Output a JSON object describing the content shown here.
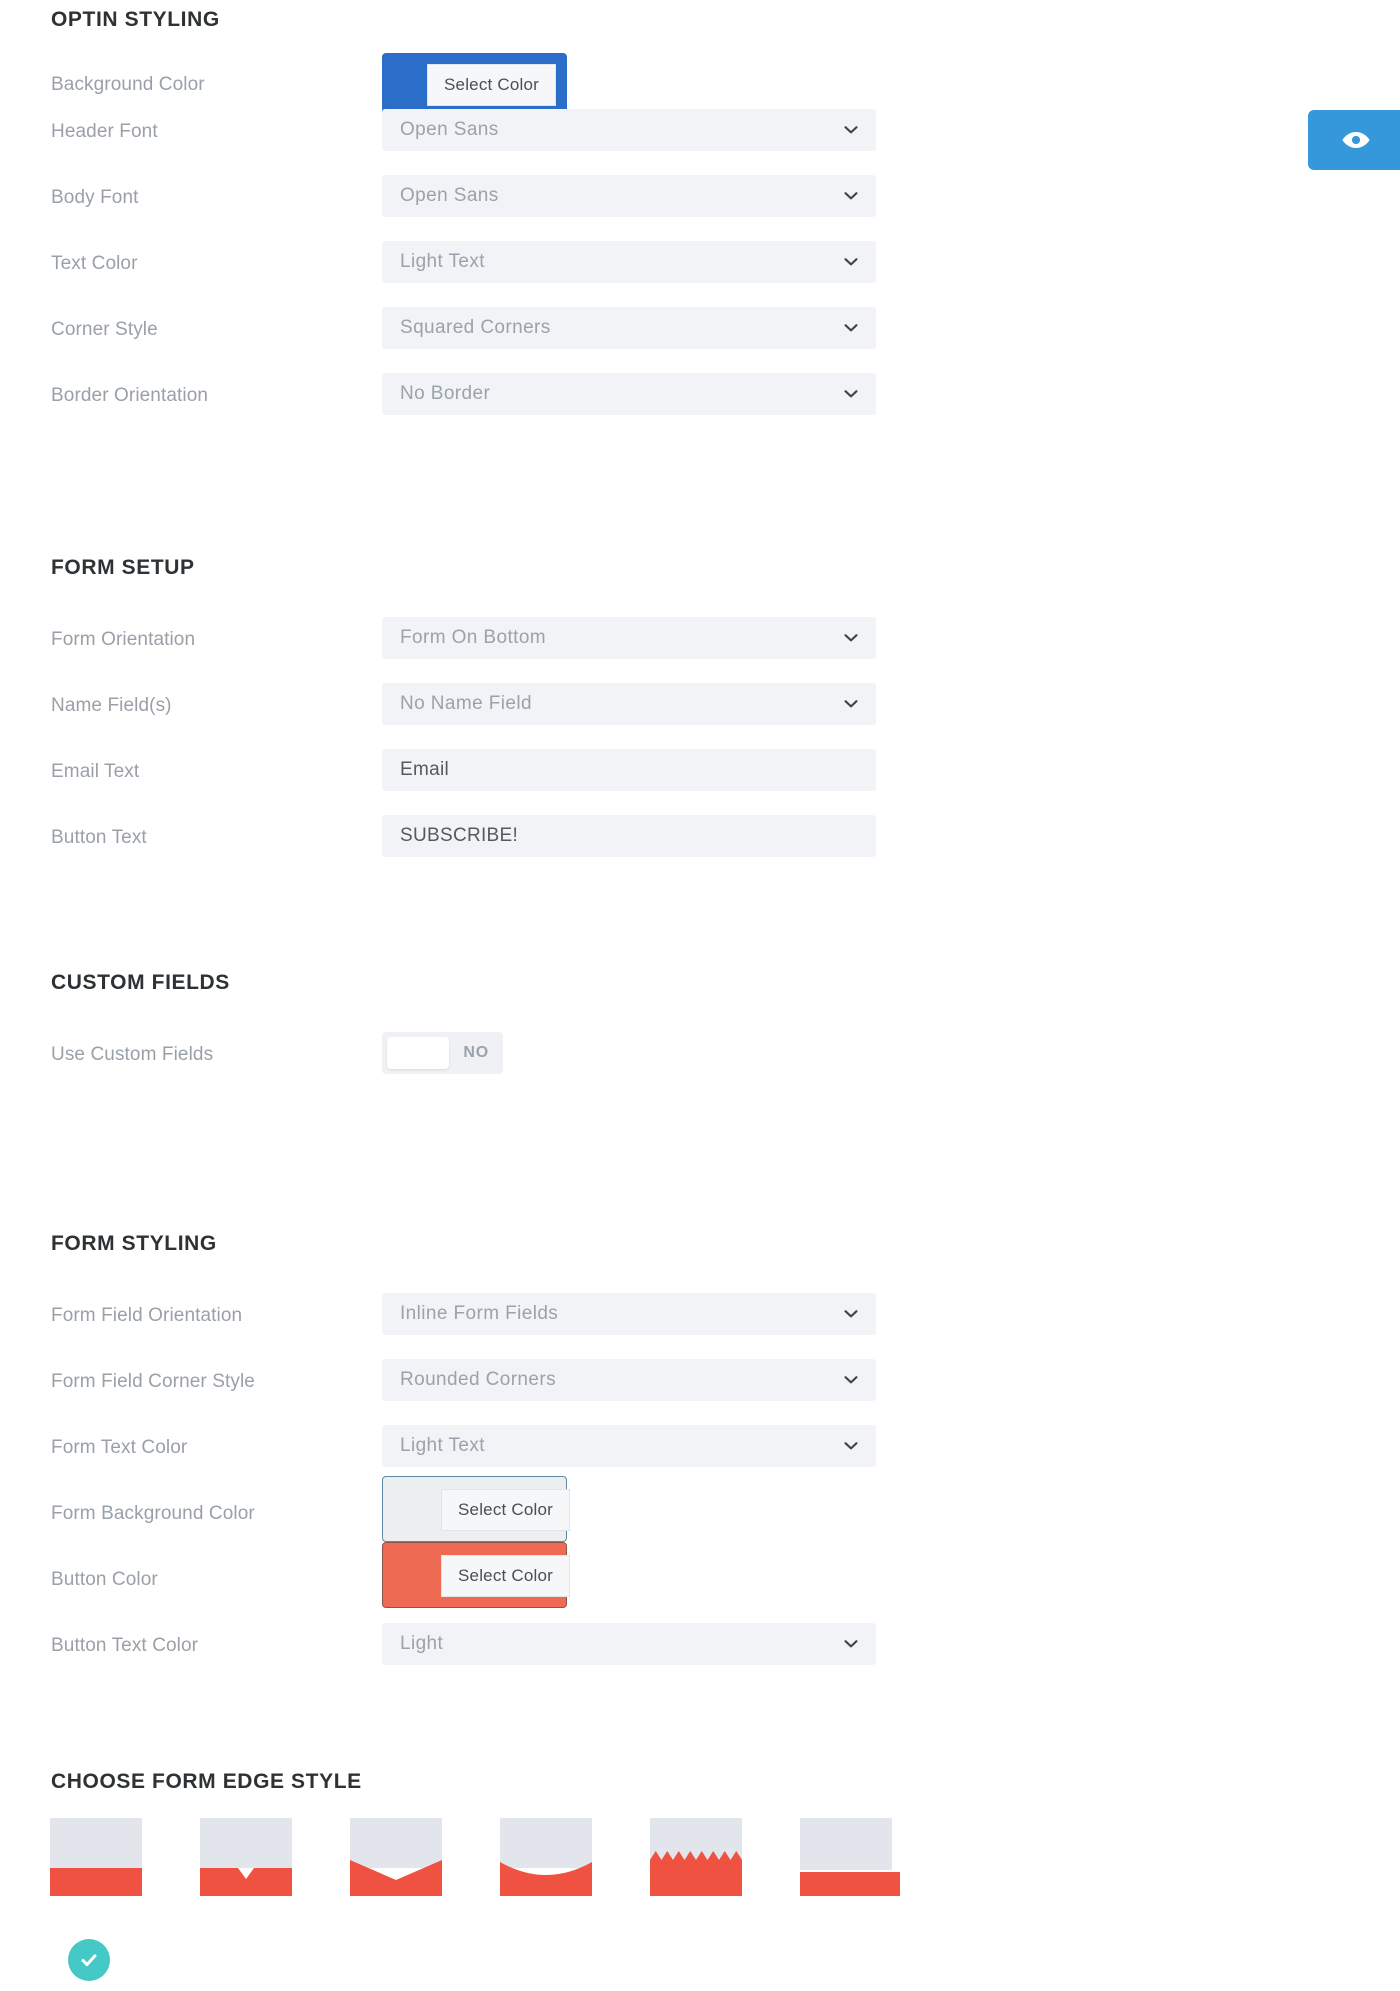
{
  "colors": {
    "background_color_swatch": "#2a6ec9",
    "form_background_color_swatch": "#eceef0",
    "button_color_swatch": "#ef6a52",
    "accent_blue": "#3498db",
    "check_teal": "#45c9c6",
    "edge_fill_red": "#ef5241",
    "edge_fill_gray": "#e2e5ec"
  },
  "sections": {
    "optin_styling": {
      "title": "OPTIN STYLING",
      "rows": [
        {
          "label": "Background Color",
          "type": "color",
          "button_label": "Select Color"
        },
        {
          "label": "Header Font",
          "type": "select",
          "value": "Open Sans"
        },
        {
          "label": "Body Font",
          "type": "select",
          "value": "Open Sans"
        },
        {
          "label": "Text Color",
          "type": "select",
          "value": "Light Text"
        },
        {
          "label": "Corner Style",
          "type": "select",
          "value": "Squared Corners"
        },
        {
          "label": "Border Orientation",
          "type": "select",
          "value": "No Border"
        }
      ]
    },
    "form_setup": {
      "title": "FORM SETUP",
      "rows": [
        {
          "label": "Form Orientation",
          "type": "select",
          "value": "Form On Bottom"
        },
        {
          "label": "Name Field(s)",
          "type": "select",
          "value": "No Name Field"
        },
        {
          "label": "Email Text",
          "type": "input",
          "value": "Email"
        },
        {
          "label": "Button Text",
          "type": "input",
          "value": "SUBSCRIBE!"
        }
      ]
    },
    "custom_fields": {
      "title": "CUSTOM FIELDS",
      "rows": [
        {
          "label": "Use Custom Fields",
          "type": "toggle",
          "value": "NO"
        }
      ]
    },
    "form_styling": {
      "title": "FORM STYLING",
      "rows": [
        {
          "label": "Form Field Orientation",
          "type": "select",
          "value": "Inline Form Fields"
        },
        {
          "label": "Form Field Corner Style",
          "type": "select",
          "value": "Rounded Corners"
        },
        {
          "label": "Form Text Color",
          "type": "select",
          "value": "Light Text"
        },
        {
          "label": "Form Background Color",
          "type": "color",
          "button_label": "Select Color"
        },
        {
          "label": "Button Color",
          "type": "color",
          "button_label": "Select Color"
        },
        {
          "label": "Button Text Color",
          "type": "select",
          "value": "Light"
        }
      ]
    },
    "form_edge_style": {
      "title": "CHOOSE FORM EDGE STYLE",
      "options": [
        {
          "name": "flat-edge",
          "selected": true
        },
        {
          "name": "notch-edge",
          "selected": false
        },
        {
          "name": "chevron-edge",
          "selected": false
        },
        {
          "name": "arc-edge",
          "selected": false
        },
        {
          "name": "zigzag-edge",
          "selected": false
        },
        {
          "name": "offset-bar-edge",
          "selected": false
        }
      ]
    }
  },
  "preview_button": {
    "icon": "eye-icon"
  }
}
